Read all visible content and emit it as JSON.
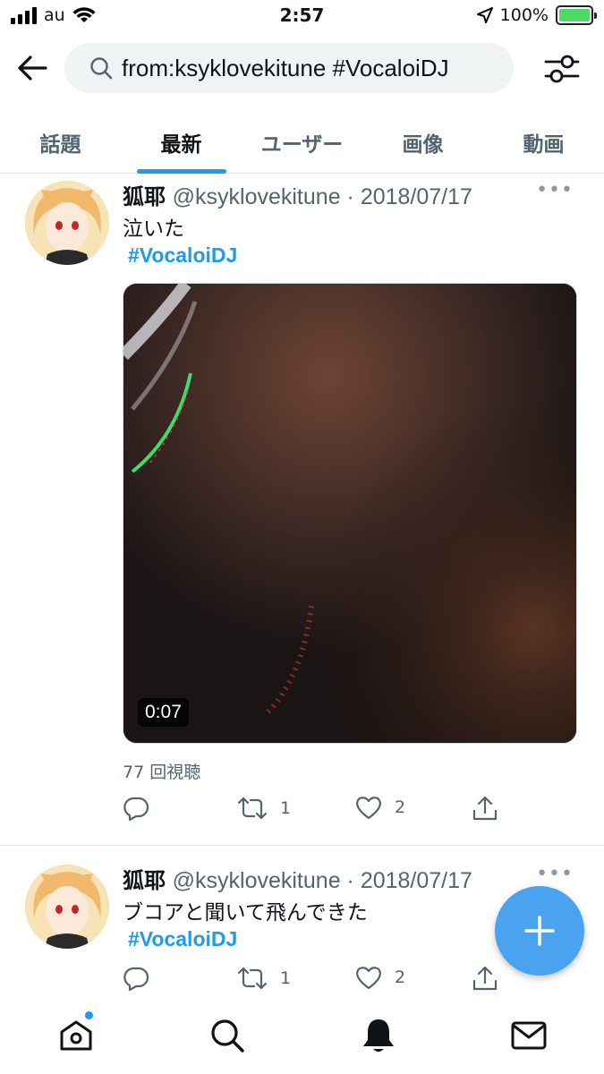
{
  "status_bar": {
    "carrier": "au",
    "time": "2:57",
    "battery": "100%"
  },
  "search": {
    "query": "from:ksyklovekitune #VocaloiDJ"
  },
  "tabs": [
    {
      "label": "話題",
      "active": false
    },
    {
      "label": "最新",
      "active": true
    },
    {
      "label": "ユーザー",
      "active": false
    },
    {
      "label": "画像",
      "active": false
    },
    {
      "label": "動画",
      "active": false
    }
  ],
  "tweets": [
    {
      "name": "狐耶",
      "handle": "@ksyklovekitune",
      "date": "2018/07/17",
      "text": "泣いた",
      "hashtag": "#VocaloiDJ",
      "video_duration": "0:07",
      "views": "77 回視聴",
      "retweets": "1",
      "likes": "2"
    },
    {
      "name": "狐耶",
      "handle": "@ksyklovekitune",
      "date": "2018/07/17",
      "text": "ブコアと聞いて飛んできた",
      "hashtag": "#VocaloiDJ",
      "retweets": "1",
      "likes": "2"
    }
  ],
  "colors": {
    "accent": "#1d9bf0",
    "fab": "#4aa3ef",
    "secondary_text": "#536471"
  },
  "icons": {
    "back": "arrow-left-icon",
    "search": "search-icon",
    "filter": "sliders-icon",
    "reply": "reply-icon",
    "retweet": "retweet-icon",
    "like": "heart-icon",
    "share": "share-icon",
    "compose": "plus-icon",
    "home": "home-icon",
    "explore": "search-icon",
    "notifications": "bell-icon",
    "messages": "mail-icon"
  }
}
